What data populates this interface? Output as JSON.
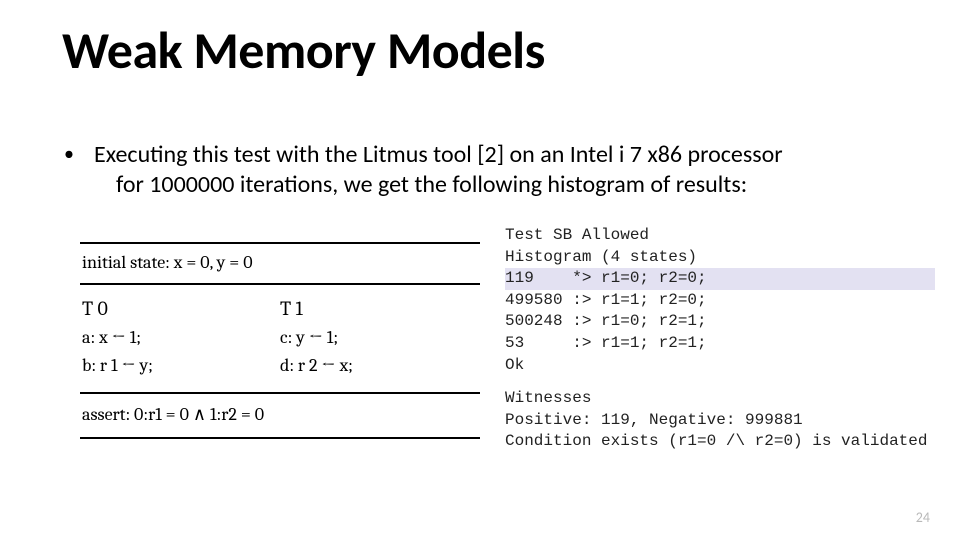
{
  "title": "Weak Memory Models",
  "bullet": {
    "line1": "Executing this test with the Litmus tool [2] on an Intel i 7 x86 processor",
    "line2": "for 1000000 iterations, we get the following histogram of results:"
  },
  "litmus": {
    "initial": "initial state: x = 0, y = 0",
    "t0": {
      "head": "T 0",
      "a": "a:  x  ←  1;",
      "b": "b:  r 1  ←  y;"
    },
    "t1": {
      "head": "T 1",
      "c": "c:  y  ←  1;",
      "d": "d:  r 2  ←  x;"
    },
    "assert": "assert: 0:r1 = 0 ∧ 1:r2 = 0"
  },
  "output": {
    "l1": "Test SB Allowed",
    "l2": "Histogram (4 states)",
    "l3": "119    *> r1=0; r2=0;",
    "l4": "499580 :> r1=1; r2=0;",
    "l5": "500248 :> r1=0; r2=1;",
    "l6": "53     :> r1=1; r2=1;",
    "l7": "Ok",
    "l8": "Witnesses",
    "l9": "Positive: 119, Negative: 999881",
    "l10": "Condition exists (r1=0 /\\ r2=0) is validated"
  },
  "page": "24"
}
